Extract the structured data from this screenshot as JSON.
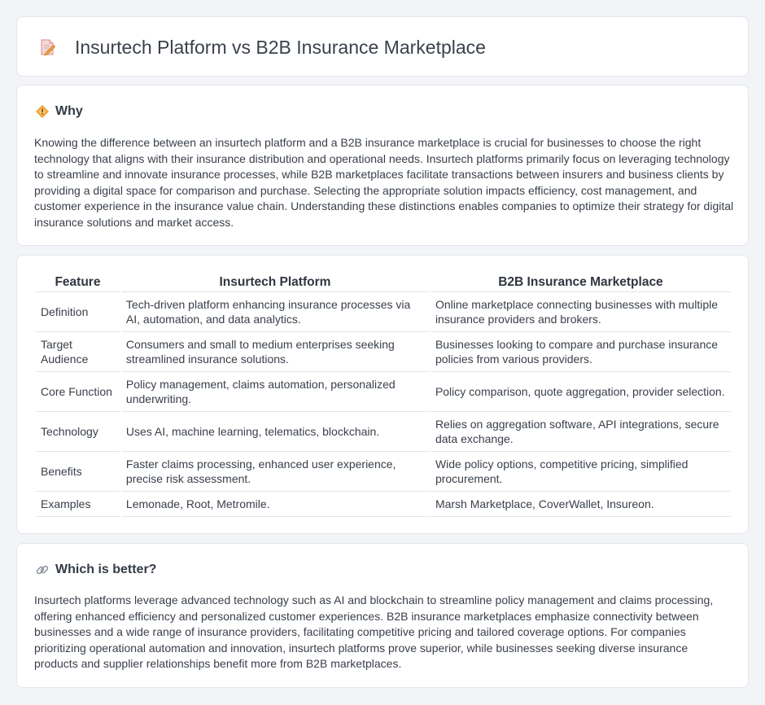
{
  "header": {
    "title": "Insurtech Platform vs B2B Insurance Marketplace",
    "icon": "document-pencil-icon"
  },
  "why": {
    "title": "Why",
    "icon": "diamond-warning-icon",
    "text": "Knowing the difference between an insurtech platform and a B2B insurance marketplace is crucial for businesses to choose the right technology that aligns with their insurance distribution and operational needs. Insurtech platforms primarily focus on leveraging technology to streamline and innovate insurance processes, while B2B marketplaces facilitate transactions between insurers and business clients by providing a digital space for comparison and purchase. Selecting the appropriate solution impacts efficiency, cost management, and customer experience in the insurance value chain. Understanding these distinctions enables companies to optimize their strategy for digital insurance solutions and market access."
  },
  "table": {
    "headers": [
      "Feature",
      "Insurtech Platform",
      "B2B Insurance Marketplace"
    ],
    "rows": [
      [
        "Definition",
        "Tech-driven platform enhancing insurance processes via AI, automation, and data analytics.",
        "Online marketplace connecting businesses with multiple insurance providers and brokers."
      ],
      [
        "Target Audience",
        "Consumers and small to medium enterprises seeking streamlined insurance solutions.",
        "Businesses looking to compare and purchase insurance policies from various providers."
      ],
      [
        "Core Function",
        "Policy management, claims automation, personalized underwriting.",
        "Policy comparison, quote aggregation, provider selection."
      ],
      [
        "Technology",
        "Uses AI, machine learning, telematics, blockchain.",
        "Relies on aggregation software, API integrations, secure data exchange."
      ],
      [
        "Benefits",
        "Faster claims processing, enhanced user experience, precise risk assessment.",
        "Wide policy options, competitive pricing, simplified procurement."
      ],
      [
        "Examples",
        "Lemonade, Root, Metromile.",
        "Marsh Marketplace, CoverWallet, Insureon."
      ]
    ]
  },
  "which": {
    "title": "Which is better?",
    "icon": "link-icon",
    "text": "Insurtech platforms leverage advanced technology such as AI and blockchain to streamline policy management and claims processing, offering enhanced efficiency and personalized customer experiences. B2B insurance marketplaces emphasize connectivity between businesses and a wide range of insurance providers, facilitating competitive pricing and tailored coverage options. For companies prioritizing operational automation and innovation, insurtech platforms prove superior, while businesses seeking diverse insurance products and supplier relationships benefit more from B2B marketplaces."
  },
  "colors": {
    "background": "#f3f4f7",
    "card": "#ffffff",
    "icon_accent": "#f0a23b",
    "icon_pink": "#e57a7a"
  }
}
